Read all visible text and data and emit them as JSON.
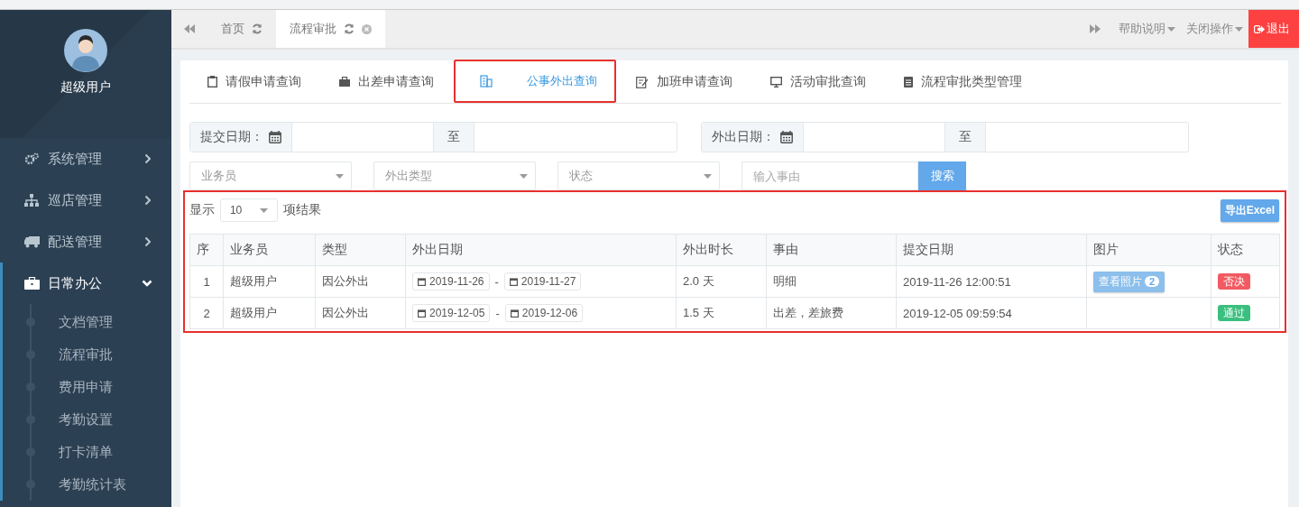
{
  "user": {
    "name": "超级用户"
  },
  "sidebar": {
    "items": [
      {
        "label": "系统管理",
        "expanded": false
      },
      {
        "label": "巡店管理",
        "expanded": false
      },
      {
        "label": "配送管理",
        "expanded": false
      },
      {
        "label": "日常办公",
        "expanded": true,
        "children": [
          {
            "label": "文档管理"
          },
          {
            "label": "流程审批"
          },
          {
            "label": "费用申请"
          },
          {
            "label": "考勤设置"
          },
          {
            "label": "打卡清单"
          },
          {
            "label": "考勤统计表"
          }
        ]
      }
    ]
  },
  "top_tabs": [
    {
      "label": "首页",
      "selected": false,
      "closable": false
    },
    {
      "label": "流程审批",
      "selected": true,
      "closable": true
    }
  ],
  "top_actions": [
    {
      "label": "帮助说明"
    },
    {
      "label": "关闭操作"
    }
  ],
  "logout": {
    "label": "退出"
  },
  "query_tabs": [
    {
      "label": "请假申请查询",
      "selected": false,
      "highlighted": false
    },
    {
      "label": "出差申请查询",
      "selected": false,
      "highlighted": false
    },
    {
      "label": "公事外出查询",
      "selected": true,
      "highlighted": true
    },
    {
      "label": "加班申请查询",
      "selected": false,
      "highlighted": false
    },
    {
      "label": "活动审批查询",
      "selected": false,
      "highlighted": false
    },
    {
      "label": "流程审批类型管理",
      "selected": false,
      "highlighted": false
    }
  ],
  "filters": {
    "date_ranges": [
      {
        "label": "提交日期：",
        "separator": "至"
      },
      {
        "label": "外出日期：",
        "separator": "至"
      }
    ],
    "selects": [
      {
        "placeholder": "业务员"
      },
      {
        "placeholder": "外出类型"
      },
      {
        "placeholder": "状态"
      }
    ],
    "search": {
      "placeholder": "输入事由",
      "button": "搜索"
    }
  },
  "results": {
    "highlighted": true,
    "show_label": "显示",
    "page_size": "10",
    "suffix": "项结果",
    "export": "导出Excel",
    "table": {
      "columns": [
        "序",
        "业务员",
        "类型",
        "外出日期",
        "外出时长",
        "事由",
        "提交日期",
        "图片",
        "状态"
      ],
      "rows": [
        {
          "index": "1",
          "staff": "超级用户",
          "type": "因公外出",
          "start": "2019-11-26",
          "date_separator": "-",
          "end": "2019-11-27",
          "duration": "2.0 天",
          "reason": "明细",
          "submitted": "2019-11-26 12:00:51",
          "photos": {
            "label": "查看照片",
            "count": "2"
          },
          "status": {
            "label": "否决",
            "color": "#f25a62"
          }
        },
        {
          "index": "2",
          "staff": "超级用户",
          "type": "因公外出",
          "start": "2019-12-05",
          "date_separator": "-",
          "end": "2019-12-06",
          "duration": "1.5 天",
          "reason": "出差，差旅费",
          "submitted": "2019-12-05 09:59:54",
          "status": {
            "label": "通过",
            "color": "#3bbf7f"
          }
        }
      ]
    }
  }
}
